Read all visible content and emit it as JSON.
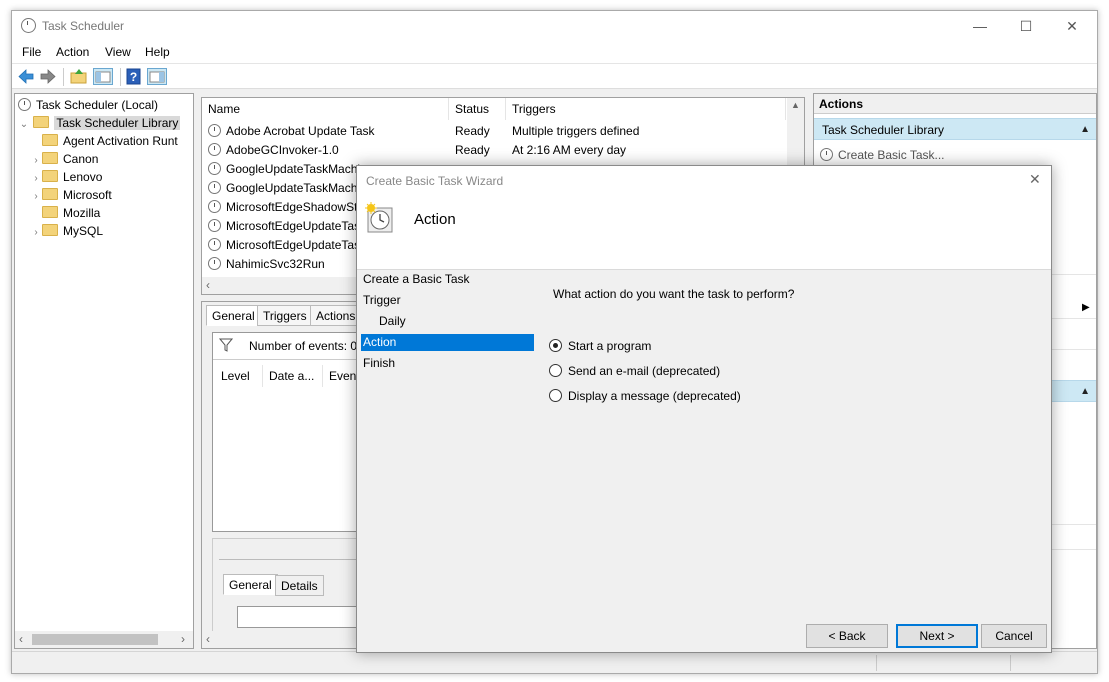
{
  "window": {
    "title": "Task Scheduler",
    "controls": {
      "minimize": "—",
      "maximize": "☐",
      "close": "✕"
    }
  },
  "menu": [
    "File",
    "Action",
    "View",
    "Help"
  ],
  "tree": {
    "root": "Task Scheduler (Local)",
    "library": "Task Scheduler Library",
    "children": [
      "Agent Activation Runt",
      "Canon",
      "Lenovo",
      "Microsoft",
      "Mozilla",
      "MySQL"
    ]
  },
  "task_list": {
    "columns": [
      "Name",
      "Status",
      "Triggers"
    ],
    "rows": [
      {
        "name": "Adobe Acrobat Update Task",
        "status": "Ready",
        "triggers": "Multiple triggers defined"
      },
      {
        "name": "AdobeGCInvoker-1.0",
        "status": "Ready",
        "triggers": "At 2:16 AM every day"
      },
      {
        "name": "GoogleUpdateTaskMachi",
        "status": "",
        "triggers": ""
      },
      {
        "name": "GoogleUpdateTaskMachi",
        "status": "",
        "triggers": ""
      },
      {
        "name": "MicrosoftEdgeShadowSta",
        "status": "",
        "triggers": ""
      },
      {
        "name": "MicrosoftEdgeUpdateTas",
        "status": "",
        "triggers": ""
      },
      {
        "name": "MicrosoftEdgeUpdateTas",
        "status": "",
        "triggers": ""
      },
      {
        "name": "NahimicSvc32Run",
        "status": "",
        "triggers": ""
      }
    ]
  },
  "detail_tabs": [
    "General",
    "Triggers",
    "Actions"
  ],
  "history": {
    "events_label": "Number of events: 0",
    "columns": [
      "Level",
      "Date a...",
      "Event"
    ]
  },
  "lower_tabs": [
    "General",
    "Details"
  ],
  "actions_pane": {
    "title": "Actions",
    "section": "Task Scheduler Library",
    "first_item": "Create Basic Task..."
  },
  "wizard": {
    "title": "Create Basic Task Wizard",
    "header": "Action",
    "steps": [
      "Create a Basic Task",
      "Trigger",
      "Daily",
      "Action",
      "Finish"
    ],
    "active_step": "Action",
    "question": "What action do you want the task to perform?",
    "options": [
      {
        "label": "Start a program",
        "selected": true
      },
      {
        "label": "Send an e-mail (deprecated)",
        "selected": false
      },
      {
        "label": "Display a message (deprecated)",
        "selected": false
      }
    ],
    "buttons": {
      "back": "< Back",
      "next": "Next >",
      "cancel": "Cancel"
    },
    "close": "✕"
  },
  "colors": {
    "selection": "#0078d7",
    "actions_section": "#cde8f4"
  }
}
